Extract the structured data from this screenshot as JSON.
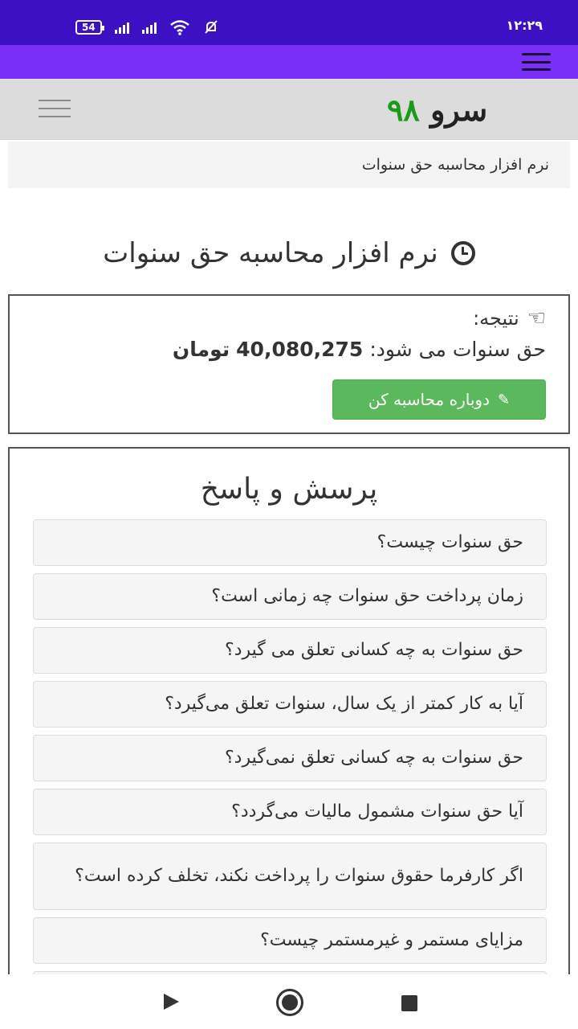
{
  "status_bar": {
    "time": "۱۲:۲۹",
    "battery": "54"
  },
  "site": {
    "logo_part1": "سرو",
    "logo_part2": "۹۸",
    "breadcrumb": "نرم افزار محاسبه حق سنوات"
  },
  "page": {
    "title": "نرم افزار محاسبه حق سنوات"
  },
  "result": {
    "label": "نتیجه:",
    "prefix": "حق سنوات می شود:",
    "amount": "40,080,275",
    "unit": "تومان",
    "recalc_label": "دوباره محاسبه کن"
  },
  "faq": {
    "title": "پرسش و پاسخ",
    "items": [
      "حق سنوات چیست؟",
      "زمان پرداخت حق سنوات چه زمانی است؟",
      "حق سنوات به چه کسانی تعلق می گیرد؟",
      "آیا به کار کمتر از یک سال، سنوات تعلق می‌گیرد؟",
      "حق سنوات به چه کسانی تعلق نمی‌گیرد؟",
      "آیا حق سنوات مشمول مالیات می‌گردد؟",
      "اگر کارفرما حقوق سنوات را پرداخت نکند، تخلف کرده است؟",
      "مزایای مستمر و غیرمستمر چیست؟"
    ]
  },
  "colors": {
    "status_bar": "#3d10c4",
    "app_bar": "#7a2ff7",
    "logo_number": "#1a9c1a",
    "button": "#5cb85c"
  },
  "icons": {
    "title": "clock-icon",
    "result": "hand-point-icon",
    "button": "pencil-icon"
  }
}
